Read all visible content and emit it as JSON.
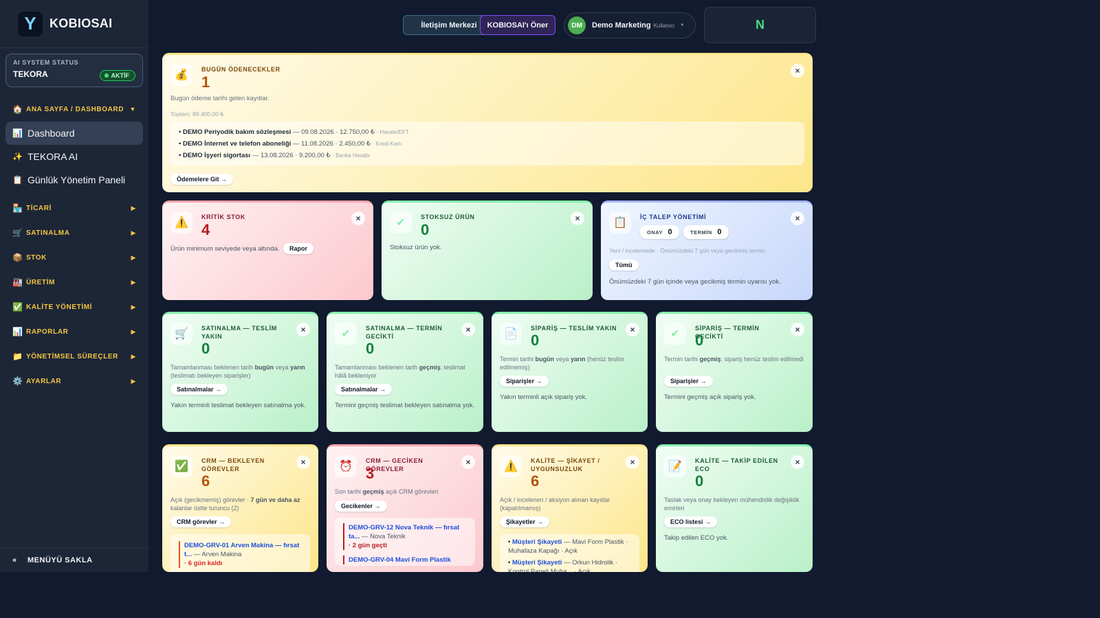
{
  "app": {
    "logo_letter": "Y",
    "name": "KOBIOSAI"
  },
  "status": {
    "label": "AI SYSTEM STATUS",
    "name": "TEKORA",
    "badge": "AKTİF"
  },
  "menu": {
    "dashboard_section": "ANA SAYFA / DASHBOARD",
    "items": [
      {
        "label": "Dashboard",
        "icon": "chart-icon"
      },
      {
        "label": "TEKORA AI",
        "icon": "sparkle-icon"
      },
      {
        "label": "Günlük Yönetim Paneli",
        "icon": "clipboard-icon"
      }
    ],
    "sections": [
      {
        "label": "TİCARİ",
        "icon": "shop-icon"
      },
      {
        "label": "SATINALMA",
        "icon": "cart-icon"
      },
      {
        "label": "STOK",
        "icon": "box-icon"
      },
      {
        "label": "ÜRETİM",
        "icon": "factory-icon"
      },
      {
        "label": "KALİTE YÖNETİMİ",
        "icon": "check-icon"
      },
      {
        "label": "RAPORLAR",
        "icon": "chart-icon"
      },
      {
        "label": "YÖNETİMSEL SÜREÇLER",
        "icon": "folder-icon"
      },
      {
        "label": "AYARLAR",
        "icon": "gear-icon"
      }
    ],
    "collapse": "MENÜYÜ SAKLA"
  },
  "topbar": {
    "iletisim": "İletişim Merkezi",
    "oner": "KOBIOSAI'ı Öner",
    "user_initials": "DM",
    "user_name": "Demo Marketing",
    "user_role": "Kullanıcı",
    "nbox": "N"
  },
  "payments": {
    "title": "BUGÜN ÖDENECEKLER",
    "count": "1",
    "desc": "Bugün ödeme tarihi gelen kayıtlar.",
    "total": "Toplam: 89.400,00 ₺",
    "items": [
      {
        "name": "DEMO Periyodik bakım sözleşmesi",
        "detail": "— 09.08.2026 · 12.750,00 ₺",
        "method": "· Havale/EFT"
      },
      {
        "name": "DEMO İnternet ve telefon aboneliği",
        "detail": "— 11.08.2026 · 2.450,00 ₺",
        "method": "· Kredi Kartı"
      },
      {
        "name": "DEMO İşyeri sigortası",
        "detail": "— 13.08.2026 · 9.200,00 ₺",
        "method": "· Banka Hesabı"
      }
    ],
    "button": "Ödemelere Git →"
  },
  "critical": {
    "title": "KRİTİK STOK",
    "count": "4",
    "desc": "Ürün minimum seviyede veya altında.",
    "button": "Rapor"
  },
  "nostock": {
    "title": "STOKSUZ ÜRÜN",
    "count": "0",
    "desc": "Stoksuz ürün yok."
  },
  "internal": {
    "title": "İÇ TALEP YÖNETİMİ",
    "onay_label": "ONAY",
    "onay": "0",
    "termin_label": "TERMİN",
    "termin": "0",
    "desc": "Yeni / incelemede · Önümüzdeki 7 gün veya gecikmiş termin",
    "button": "Tümü",
    "text": "Önümüzdeki 7 gün içinde veya gecikmiş termin uyarısı yok."
  },
  "pdelivery": {
    "title": "SATINALMA — TESLİM YAKIN",
    "count": "0",
    "desc_a": "Tamamlanması beklenen tarih ",
    "desc_b": "bugün",
    "desc_c": " veya ",
    "desc_d": "yarın",
    "desc_e": " (teslimatı bekleyen siparişler)",
    "button": "Satınalmalar →",
    "text": "Yakın terminli teslimat bekleyen satınalma yok."
  },
  "plate": {
    "title": "SATINALMA — TERMİN GECİKTİ",
    "count": "0",
    "desc_a": "Tamamlanması beklenen tarih ",
    "desc_b": "geçmiş",
    "desc_c": "; teslimat hâlâ bekleniyor",
    "button": "Satınalmalar →",
    "text": "Termini geçmiş teslimat bekleyen satınalma yok."
  },
  "odelivery": {
    "title": "SİPARİŞ — TESLİM YAKIN",
    "count": "0",
    "desc_a": "Termin tarihi ",
    "desc_b": "bugün",
    "desc_c": " veya ",
    "desc_d": "yarın",
    "desc_e": " (henüz teslim edilmemiş)",
    "button": "Siparişler →",
    "text": "Yakın terminli açık sipariş yok."
  },
  "olate": {
    "title": "SİPARİŞ — TERMİN GECİKTİ",
    "count": "0",
    "desc_a": "Termin tarihi ",
    "desc_b": "geçmiş",
    "desc_c": "; sipariş henüz teslim edilmedi",
    "button": "Siparişler →",
    "text": "Termini geçmiş açık sipariş yok."
  },
  "crmpending": {
    "title": "CRM — BEKLEYEN GÖREVLER",
    "count": "6",
    "desc_a": "Açık (gecikmemiş) görevler · ",
    "desc_b": "7 gün ve daha az",
    "desc_c": " kalanlar üstte turuncu (2)",
    "button": "CRM görevler →",
    "task_link": "DEMO-GRV-01 Arven Makina — fırsat t...",
    "task_company": " — Arven Makina",
    "task_delay": "· 6 gün kaldı"
  },
  "crmlate": {
    "title": "CRM — GECİKEN GÖREVLER",
    "count": "3",
    "desc_a": "Son tarihi ",
    "desc_b": "geçmiş",
    "desc_c": " açık CRM görevleri",
    "button": "Gecikenler →",
    "task_link": "DEMO-GRV-12 Nova Teknik — fırsat ta...",
    "task_company": " — Nova Teknik",
    "task_delay": "· 2 gün geçti",
    "task2": "DEMO-GRV-04 Mavi Form Plastik"
  },
  "complaint": {
    "title": "KALİTE — ŞİKAYET / UYGUNSUZLUK",
    "count": "6",
    "desc": "Açık / incelenen / aksiyon alınan kayıtlar (kapatılmamış)",
    "button": "Şikayetler →",
    "items": [
      {
        "link": "Müşteri Şikayeti",
        "detail": " — Mavi Form Plastik · Muhafaza Kapağı · Açık"
      },
      {
        "link": "Müşteri Şikayeti",
        "detail": " — Orkun Hidrolik · Kontrol Paneli Muha... · Açık"
      }
    ]
  },
  "eco": {
    "title": "KALİTE — TAKİP EDİLEN ECO",
    "count": "0",
    "desc": "Taslak veya onay bekleyen mühendislik değişiklik emirleri",
    "button": "ECO listesi →",
    "text": "Takip edilen ECO yok."
  },
  "icons": {
    "close": "×"
  },
  "colors": {
    "accent": "#f5c542",
    "active_green": "#22c55e",
    "purple": "#7c4dff"
  }
}
